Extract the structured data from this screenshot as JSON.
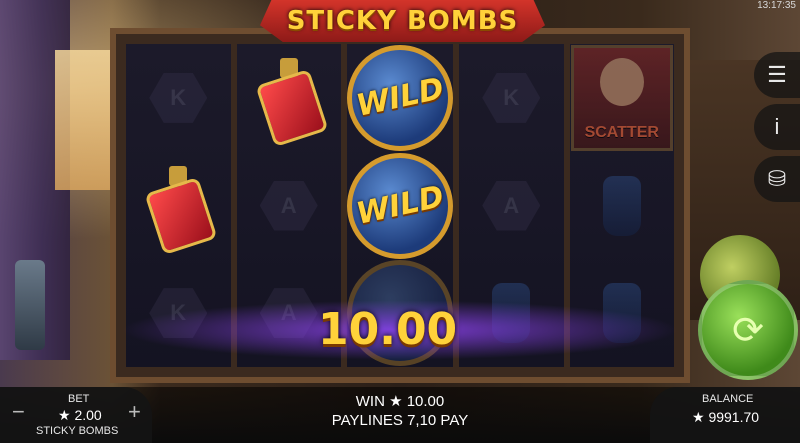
{
  "game": {
    "title": "STICKY BOMBS",
    "clock": "13:17:35"
  },
  "reels": [
    [
      "K",
      "potion",
      "K"
    ],
    [
      "potion",
      "A",
      "A"
    ],
    [
      "wild",
      "wild",
      "wild"
    ],
    [
      "K",
      "A",
      "bottle"
    ],
    [
      "scatter",
      "bottle",
      "bottle"
    ]
  ],
  "symbols": {
    "wild_label": "WILD",
    "scatter_label": "SCATTER"
  },
  "win_display": "10.00",
  "controls": {
    "menu_icon": "hamburger-icon",
    "info_icon": "info-icon",
    "coins_icon": "coins-icon",
    "spin_icon": "spin-icon"
  },
  "bottom_bar": {
    "bet_label": "BET",
    "bet_value": "★ 2.00",
    "game_name": "STICKY BOMBS",
    "win_text": "WIN ★ 10.00",
    "paylines_text": "PAYLINES 7,10 PAY",
    "balance_label": "BALANCE",
    "balance_value": "★ 9991.70"
  },
  "colors": {
    "gold": "#ffd23a",
    "spin_green": "#3f8a1a"
  }
}
